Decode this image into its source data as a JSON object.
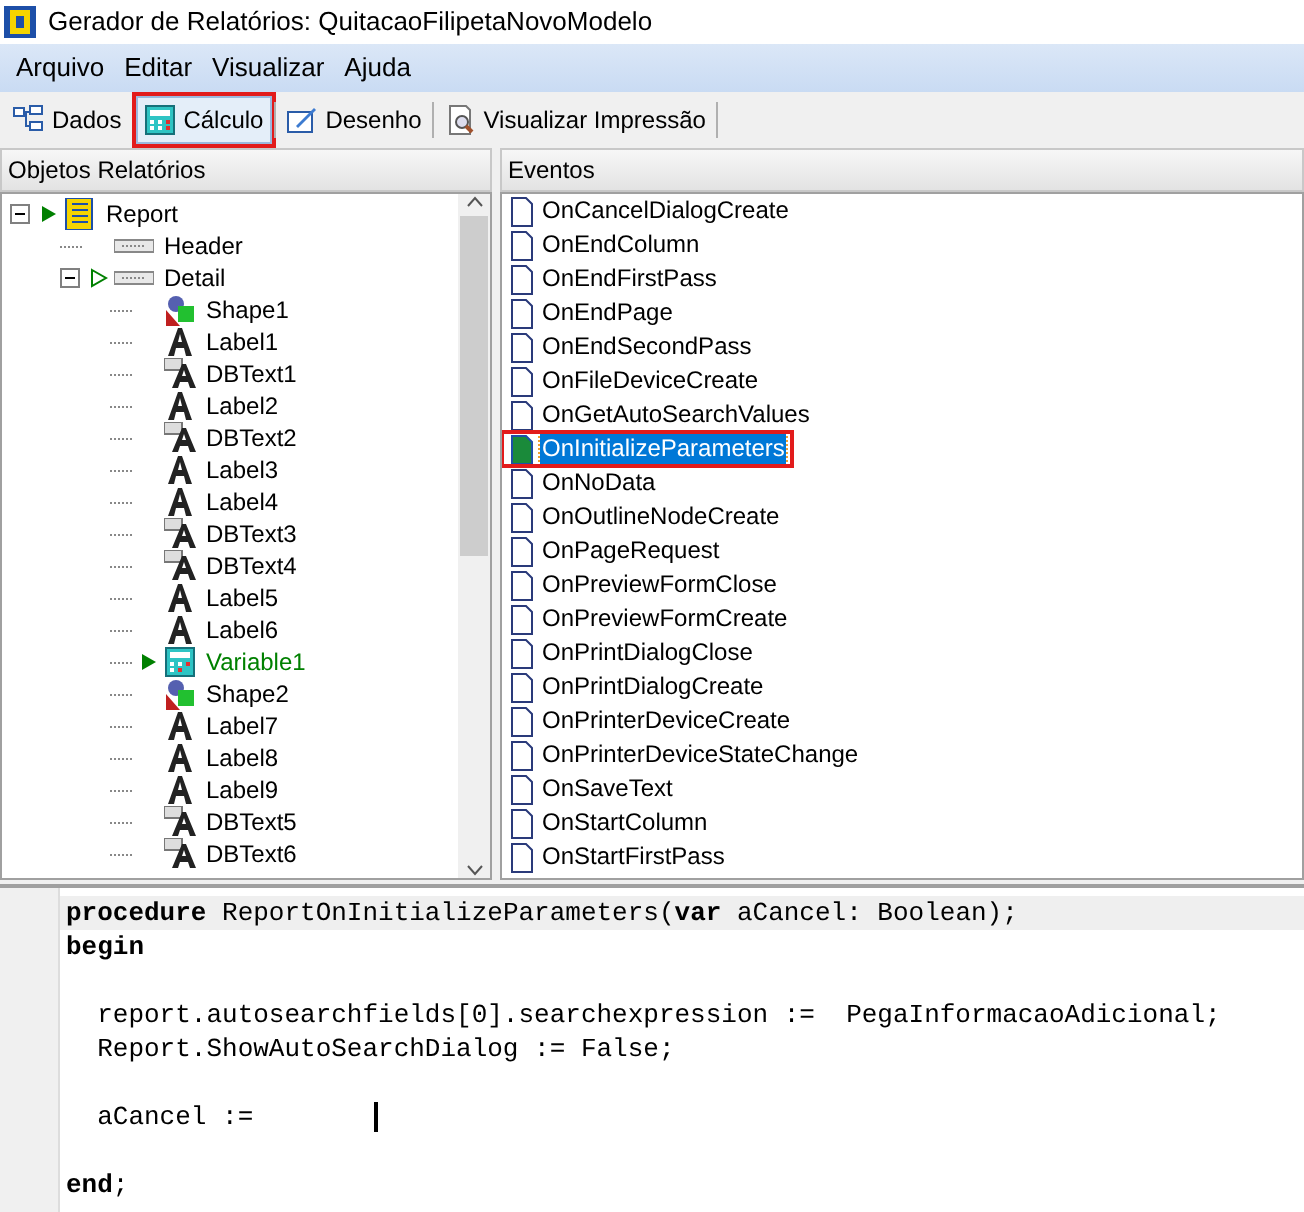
{
  "window": {
    "title": "Gerador de Relatórios: QuitacaoFilipetaNovoModelo"
  },
  "menu": [
    "Arquivo",
    "Editar",
    "Visualizar",
    "Ajuda"
  ],
  "toolbar": [
    {
      "label": "Dados",
      "kind": "data",
      "selected": false,
      "outlined": false
    },
    {
      "label": "Cálculo",
      "kind": "calc",
      "selected": true,
      "outlined": true
    },
    {
      "label": "Desenho",
      "kind": "design",
      "selected": false,
      "outlined": false
    },
    {
      "label": "Visualizar Impressão",
      "kind": "preview",
      "selected": false,
      "outlined": false
    }
  ],
  "objects_panel": {
    "title": "Objetos Relatórios",
    "tree": [
      {
        "label": "Report",
        "kind": "report",
        "expanded": true,
        "event_assigned": true,
        "children": [
          {
            "label": "Header",
            "kind": "band"
          },
          {
            "label": "Detail",
            "kind": "band",
            "expanded": true,
            "child_event": true,
            "children": [
              {
                "label": "Shape1",
                "kind": "shape"
              },
              {
                "label": "Label1",
                "kind": "label"
              },
              {
                "label": "DBText1",
                "kind": "dbtext"
              },
              {
                "label": "Label2",
                "kind": "label"
              },
              {
                "label": "DBText2",
                "kind": "dbtext"
              },
              {
                "label": "Label3",
                "kind": "label"
              },
              {
                "label": "Label4",
                "kind": "label"
              },
              {
                "label": "DBText3",
                "kind": "dbtext"
              },
              {
                "label": "DBText4",
                "kind": "dbtext"
              },
              {
                "label": "Label5",
                "kind": "label"
              },
              {
                "label": "Label6",
                "kind": "label"
              },
              {
                "label": "Variable1",
                "kind": "variable",
                "event_assigned": true,
                "highlighted": true
              },
              {
                "label": "Shape2",
                "kind": "shape"
              },
              {
                "label": "Label7",
                "kind": "label"
              },
              {
                "label": "Label8",
                "kind": "label"
              },
              {
                "label": "Label9",
                "kind": "label"
              },
              {
                "label": "DBText5",
                "kind": "dbtext"
              },
              {
                "label": "DBText6",
                "kind": "dbtext"
              }
            ]
          }
        ]
      }
    ]
  },
  "events_panel": {
    "title": "Eventos",
    "items": [
      {
        "label": "OnCancelDialogCreate",
        "selected": false,
        "outlined": false
      },
      {
        "label": "OnEndColumn",
        "selected": false,
        "outlined": false
      },
      {
        "label": "OnEndFirstPass",
        "selected": false,
        "outlined": false
      },
      {
        "label": "OnEndPage",
        "selected": false,
        "outlined": false
      },
      {
        "label": "OnEndSecondPass",
        "selected": false,
        "outlined": false
      },
      {
        "label": "OnFileDeviceCreate",
        "selected": false,
        "outlined": false
      },
      {
        "label": "OnGetAutoSearchValues",
        "selected": false,
        "outlined": false
      },
      {
        "label": "OnInitializeParameters",
        "selected": true,
        "outlined": true
      },
      {
        "label": "OnNoData",
        "selected": false,
        "outlined": false
      },
      {
        "label": "OnOutlineNodeCreate",
        "selected": false,
        "outlined": false
      },
      {
        "label": "OnPageRequest",
        "selected": false,
        "outlined": false
      },
      {
        "label": "OnPreviewFormClose",
        "selected": false,
        "outlined": false
      },
      {
        "label": "OnPreviewFormCreate",
        "selected": false,
        "outlined": false
      },
      {
        "label": "OnPrintDialogClose",
        "selected": false,
        "outlined": false
      },
      {
        "label": "OnPrintDialogCreate",
        "selected": false,
        "outlined": false
      },
      {
        "label": "OnPrinterDeviceCreate",
        "selected": false,
        "outlined": false
      },
      {
        "label": "OnPrinterDeviceStateChange",
        "selected": false,
        "outlined": false
      },
      {
        "label": "OnSaveText",
        "selected": false,
        "outlined": false
      },
      {
        "label": "OnStartColumn",
        "selected": false,
        "outlined": false
      },
      {
        "label": "OnStartFirstPass",
        "selected": false,
        "outlined": false
      }
    ]
  },
  "code_editor": {
    "lines": [
      {
        "text": "**procedure** ReportOnInitializeParameters(**var** aCancel: Boolean);",
        "current": true
      },
      {
        "text": "**begin**",
        "current": false
      },
      {
        "current": false
      },
      {
        "text": "  report.autosearchfields[0].searchexpression :=  PegaInformacaoAdicional;",
        "current": false
      },
      {
        "text": "  Report.ShowAutoSearchDialog := False;",
        "current": false
      },
      {
        "current": false
      },
      {
        "text": "  aCancel :=",
        "current": false,
        "caret": true
      },
      {
        "current": false
      },
      {
        "text": "**end**;",
        "current": false
      }
    ]
  }
}
